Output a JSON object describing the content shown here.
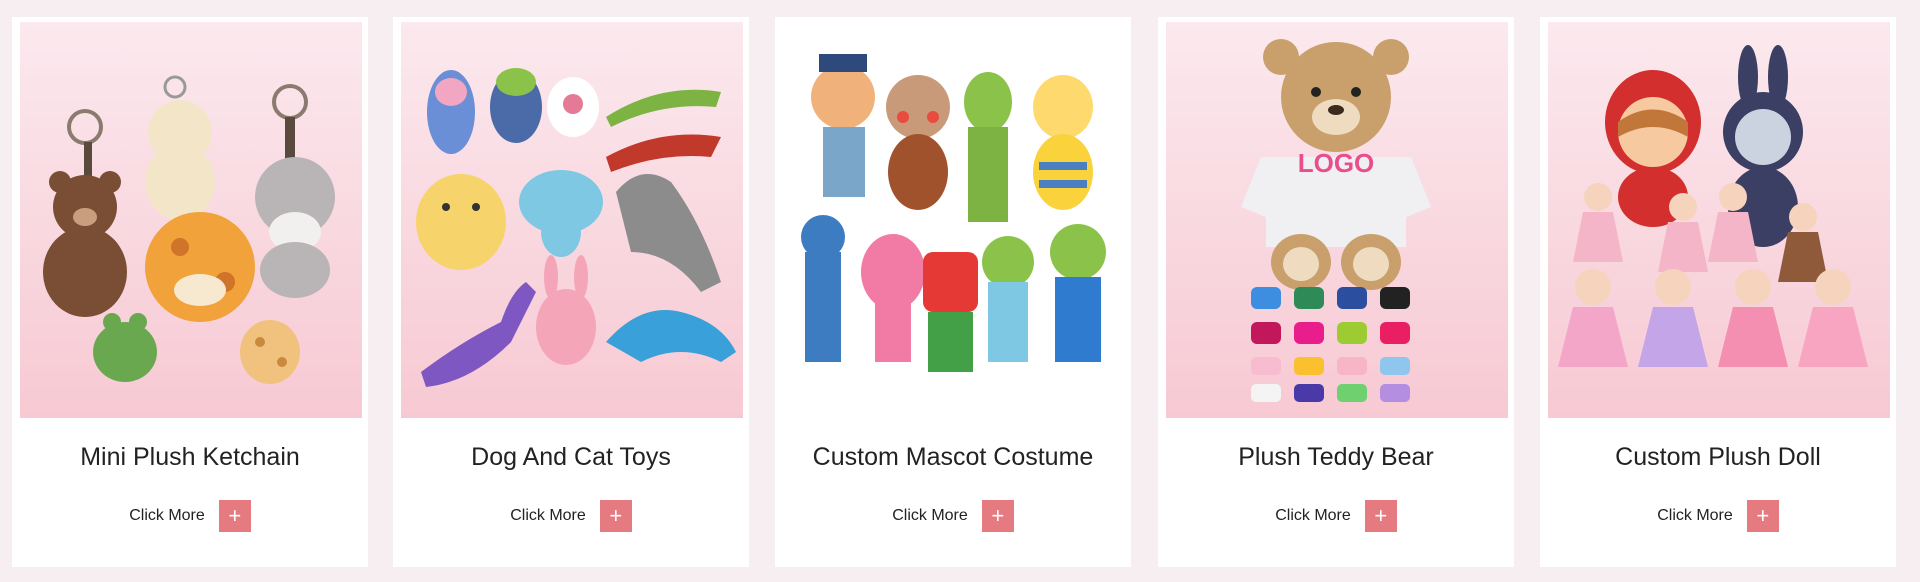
{
  "products": [
    {
      "title": "Mini Plush Ketchain",
      "button_label": "Click More",
      "plus_symbol": "+"
    },
    {
      "title": "Dog And Cat Toys",
      "button_label": "Click More",
      "plus_symbol": "+"
    },
    {
      "title": "Custom Mascot Costume",
      "button_label": "Click More",
      "plus_symbol": "+"
    },
    {
      "title": "Plush Teddy Bear",
      "button_label": "Click More",
      "plus_symbol": "+",
      "shirt_logo": "LOGO"
    },
    {
      "title": "Custom Plush Doll",
      "button_label": "Click More",
      "plus_symbol": "+"
    }
  ],
  "colors": {
    "accent": "#e57a80",
    "card_bg": "#ffffff",
    "page_bg": "#f6eef0",
    "image_bg_pink": "#f7c9d3"
  }
}
